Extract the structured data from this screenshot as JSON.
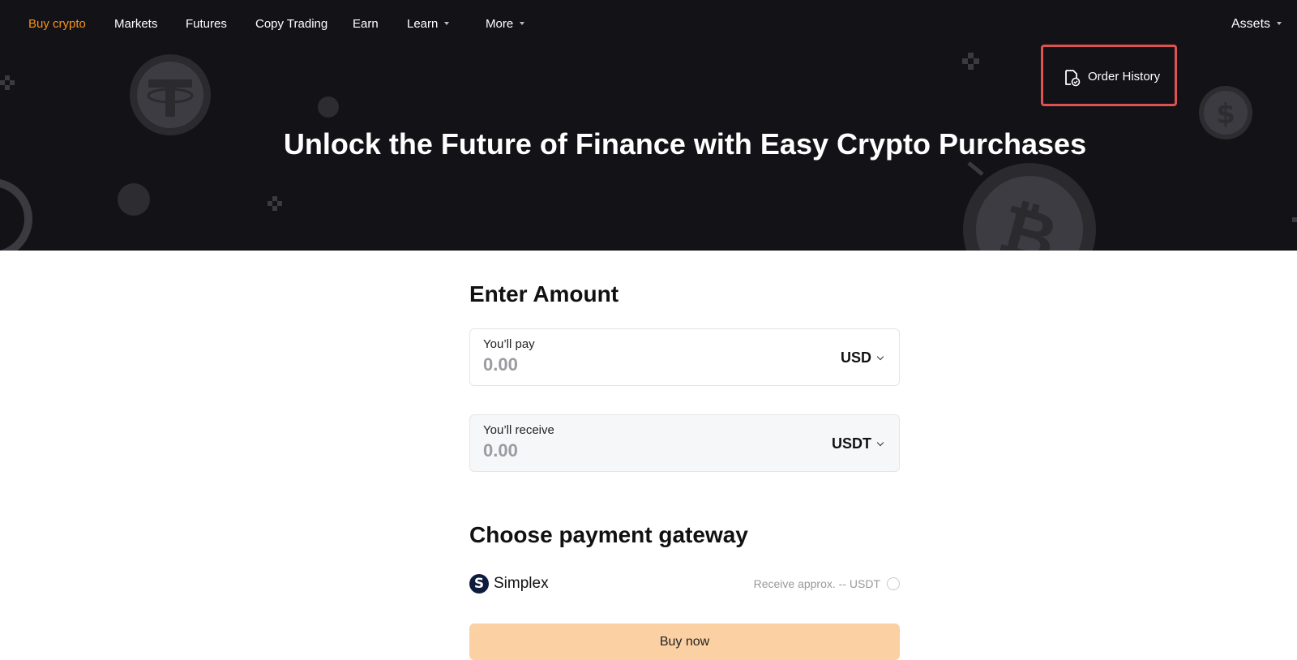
{
  "nav": {
    "items": [
      {
        "label": "Buy crypto",
        "active": true
      },
      {
        "label": "Markets"
      },
      {
        "label": "Futures"
      },
      {
        "label": "Copy Trading"
      },
      {
        "label": "Earn"
      },
      {
        "label": "Learn",
        "dropdown": true
      },
      {
        "label": "More",
        "dropdown": true
      }
    ],
    "assets": "Assets"
  },
  "hero": {
    "order_history": "Order History",
    "title": "Unlock the Future of Finance with Easy Crypto Purchases"
  },
  "amount": {
    "heading": "Enter Amount",
    "pay": {
      "label": "You’ll pay",
      "value": "0.00",
      "currency": "USD"
    },
    "receive": {
      "label": "You’ll receive",
      "value": "0.00",
      "currency": "USDT"
    }
  },
  "gateway": {
    "heading": "Choose payment gateway",
    "options": [
      {
        "name": "Simplex",
        "logo_letter": "S",
        "approx": "Receive approx. -- USDT",
        "selected": false
      }
    ]
  },
  "buy_button": "Buy now",
  "colors": {
    "accent": "#f7931a",
    "hero_bg": "#131217",
    "highlight_border": "#e05252",
    "buy_button_bg": "#fbd0a3"
  }
}
